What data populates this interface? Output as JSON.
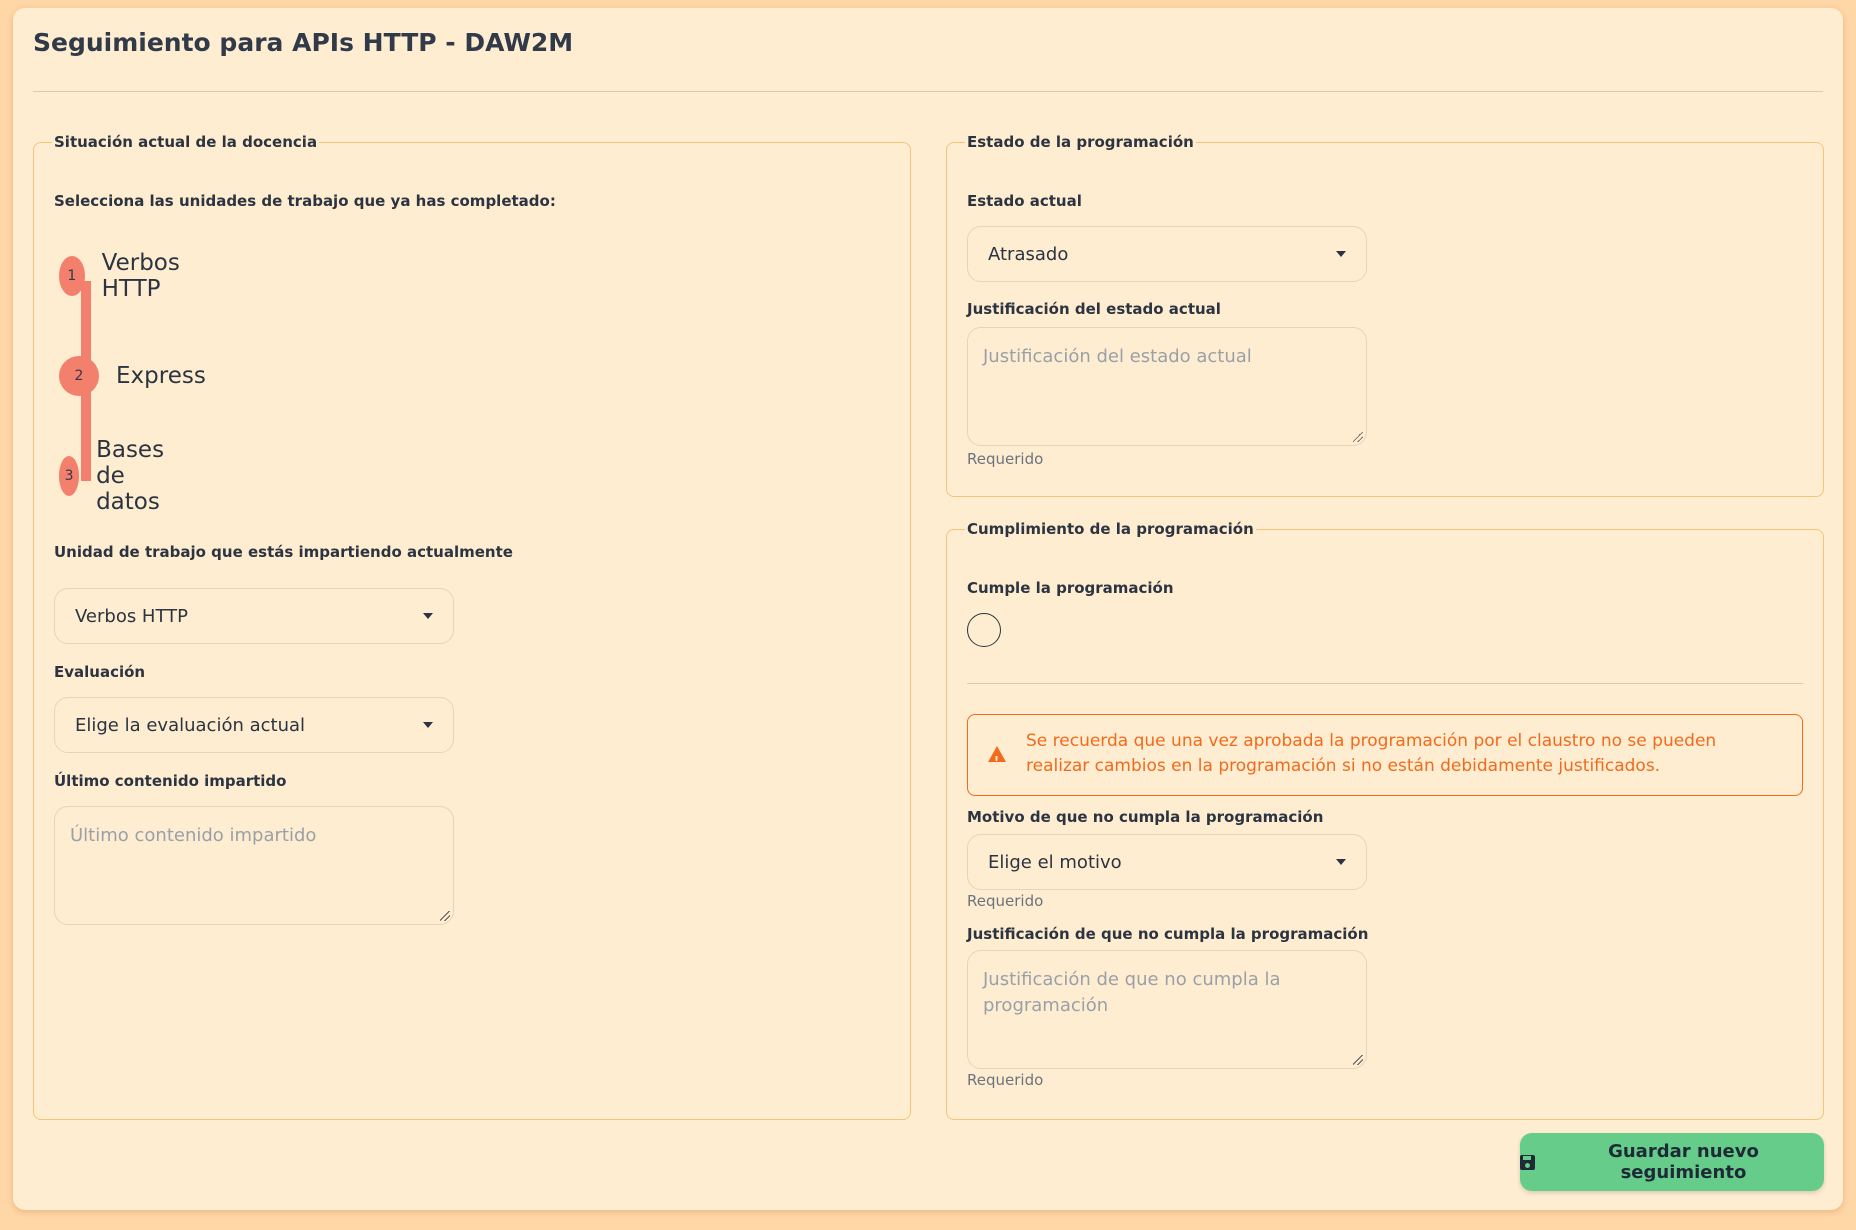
{
  "title": "Seguimiento para APIs HTTP - DAW2M",
  "left_panel": {
    "legend": "Situación actual de la docencia",
    "units_prompt": "Selecciona las unidades de trabajo que ya has completado:",
    "units": [
      {
        "num": "1",
        "label": "Verbos HTTP"
      },
      {
        "num": "2",
        "label": "Express"
      },
      {
        "num": "3",
        "label": "Bases de datos"
      }
    ],
    "current_unit_label": "Unidad de trabajo que estás impartiendo actualmente",
    "current_unit_value": "Verbos HTTP",
    "evaluation_label": "Evaluación",
    "evaluation_value": "Elige la evaluación actual",
    "last_content_label": "Último contenido impartido",
    "last_content_placeholder": "Último contenido impartido"
  },
  "status_panel": {
    "legend": "Estado de la programación",
    "current_status_label": "Estado actual",
    "current_status_value": "Atrasado",
    "justification_label": "Justificación del estado actual",
    "justification_placeholder": "Justificación del estado actual",
    "required_hint": "Requerido"
  },
  "compliance_panel": {
    "legend": "Cumplimiento de la programación",
    "complies_label": "Cumple la programación",
    "alert_text": "Se recuerda que una vez aprobada la programación por el claustro no se pueden realizar cambios en la programación si no están debidamente justificados.",
    "reason_label": "Motivo de que no cumpla la programación",
    "reason_value": "Elige el motivo",
    "reason_hint": "Requerido",
    "justification_label": "Justificación de que no cumpla la programación",
    "justification_placeholder": "Justificación de que no cumpla la programación",
    "justification_hint": "Requerido"
  },
  "save_button": "Guardar nuevo seguimiento",
  "colors": {
    "background": "#ffd6a5",
    "card": "#ffedd2",
    "step_accent": "#f37f6d",
    "alert": "#f26a1b",
    "success_button": "#66cc8a"
  },
  "icons": {
    "alert": "warning-triangle-icon",
    "save": "floppy-disk-icon",
    "select": "caret-down-icon"
  }
}
